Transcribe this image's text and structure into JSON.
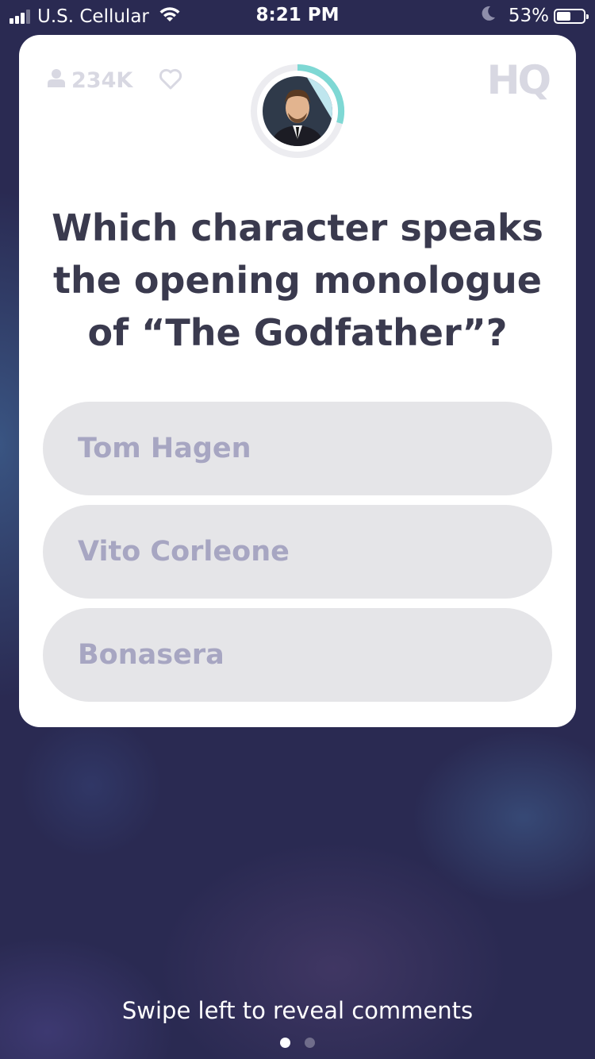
{
  "status_bar": {
    "carrier": "U.S. Cellular",
    "time": "8:21 PM",
    "battery_percent": "53%",
    "battery_level": 0.53,
    "signal_bars": 3,
    "icons": [
      "signal-icon",
      "wifi-icon",
      "moon-icon",
      "battery-icon"
    ]
  },
  "card": {
    "viewer_count": "234K",
    "logo": "HQ",
    "timer_ring_color": "#7ed8d4",
    "question": "Which character speaks the opening monologue of “The Godfather”?",
    "answers": [
      {
        "label": "Tom Hagen"
      },
      {
        "label": "Vito Corleone"
      },
      {
        "label": "Bonasera"
      }
    ]
  },
  "footer": {
    "hint": "Swipe left to reveal comments",
    "pages": 2,
    "active_page": 1
  },
  "colors": {
    "background": "#2a2a52",
    "card": "#ffffff",
    "question_text": "#3a3a4e",
    "answer_bg": "#e5e5e8",
    "answer_text": "#a7a6c2",
    "muted": "#d8d8e2"
  }
}
